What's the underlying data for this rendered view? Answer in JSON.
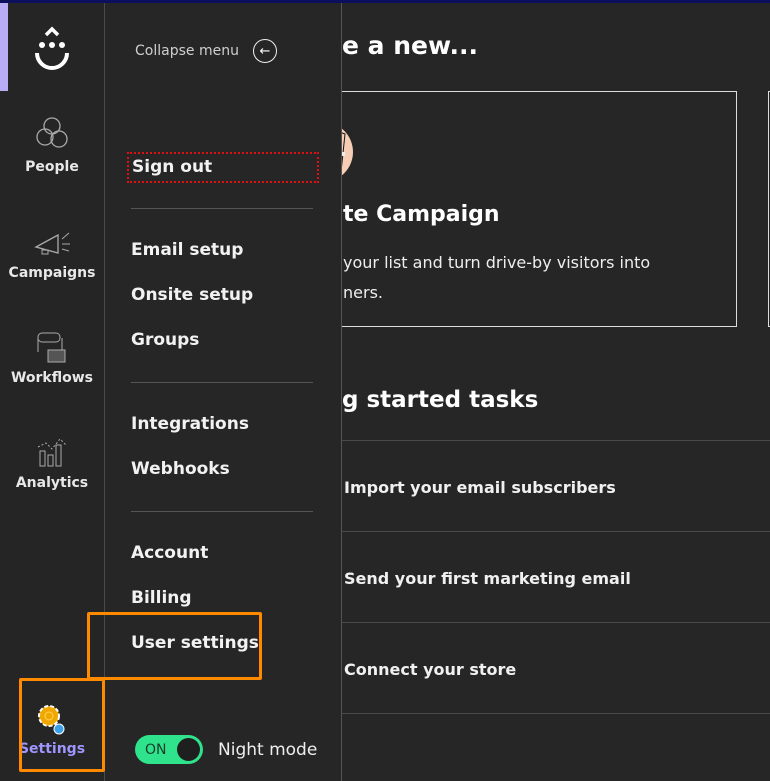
{
  "rail": {
    "items": [
      {
        "label": "People",
        "icon": "people-icon"
      },
      {
        "label": "Campaigns",
        "icon": "megaphone-icon"
      },
      {
        "label": "Workflows",
        "icon": "workflow-icon"
      },
      {
        "label": "Analytics",
        "icon": "analytics-icon"
      },
      {
        "label": "Settings",
        "icon": "settings-gear-icon"
      }
    ],
    "active_color": "#b9acf7"
  },
  "flyout": {
    "collapse_label": "Collapse menu",
    "sign_out": "Sign out",
    "groups": [
      [
        "Email setup",
        "Onsite setup",
        "Groups"
      ],
      [
        "Integrations",
        "Webhooks"
      ],
      [
        "Account",
        "Billing",
        "User settings"
      ]
    ],
    "night_mode": {
      "label": "Night mode",
      "toggle": "ON",
      "on": true,
      "color": "#2ee38b"
    }
  },
  "main": {
    "heading": "e a new...",
    "card": {
      "title": "te Campaign",
      "desc_line1": "your list and turn drive-by visitors into",
      "desc_line2": "ners."
    },
    "tasks_heading": "g started tasks",
    "tasks": [
      "Import your email subscribers",
      "Send your first marketing email",
      "Connect your store"
    ]
  },
  "highlight_color": "#ff8a00"
}
